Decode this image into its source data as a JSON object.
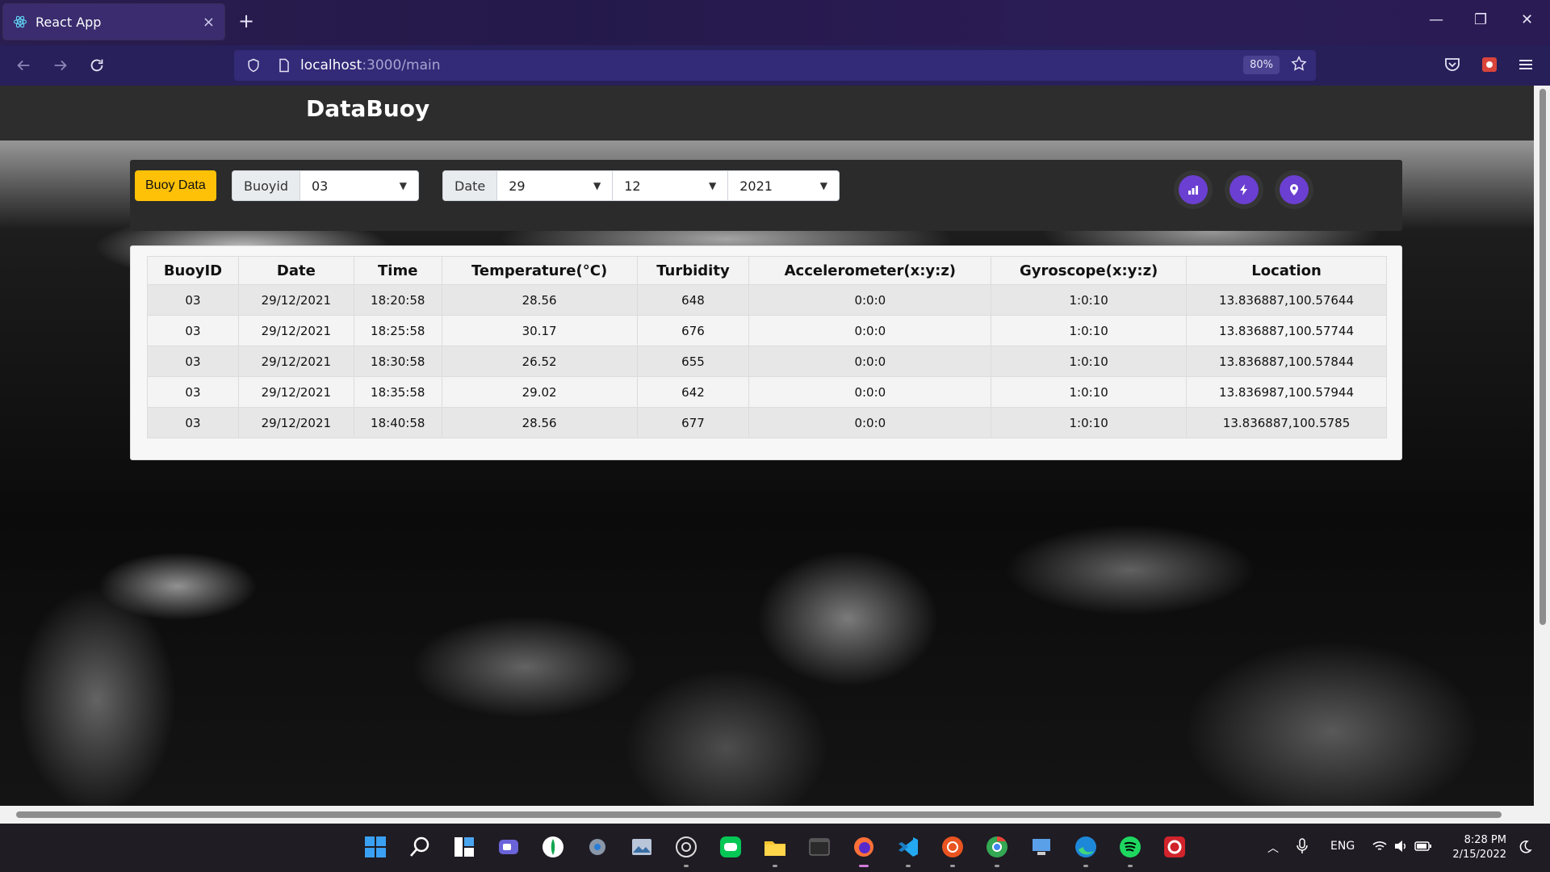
{
  "browser": {
    "tab_title": "React App",
    "tab_close": "×",
    "new_tab": "+",
    "url_host": "localhost",
    "url_path": ":3000/main",
    "zoom": "80%",
    "win_minimize": "—",
    "win_restore": "❐",
    "win_close": "✕"
  },
  "app": {
    "brand": "DataBuoy",
    "buoy_data_button": "Buoy Data",
    "buoyid_label": "Buoyid",
    "buoyid_value": "03",
    "date_label": "Date",
    "day_value": "29",
    "month_value": "12",
    "year_value": "2021"
  },
  "table": {
    "headers": [
      "BuoyID",
      "Date",
      "Time",
      "Temperature(°C)",
      "Turbidity",
      "Accelerometer(x:y:z)",
      "Gyroscope(x:y:z)",
      "Location"
    ],
    "rows": [
      [
        "03",
        "29/12/2021",
        "18:20:58",
        "28.56",
        "648",
        "0:0:0",
        "1:0:10",
        "13.836887,100.57644"
      ],
      [
        "03",
        "29/12/2021",
        "18:25:58",
        "30.17",
        "676",
        "0:0:0",
        "1:0:10",
        "13.836887,100.57744"
      ],
      [
        "03",
        "29/12/2021",
        "18:30:58",
        "26.52",
        "655",
        "0:0:0",
        "1:0:10",
        "13.836887,100.57844"
      ],
      [
        "03",
        "29/12/2021",
        "18:35:58",
        "29.02",
        "642",
        "0:0:0",
        "1:0:10",
        "13.836987,100.57944"
      ],
      [
        "03",
        "29/12/2021",
        "18:40:58",
        "28.56",
        "677",
        "0:0:0",
        "1:0:10",
        "13.836887,100.5785"
      ]
    ]
  },
  "taskbar": {
    "language": "ENG",
    "time": "8:28 PM",
    "date": "2/15/2022"
  },
  "colors": {
    "accent_yellow": "#ffc107",
    "icon_button_purple": "#6b3fd1",
    "browser_tabbar": "#2a1d4f"
  }
}
